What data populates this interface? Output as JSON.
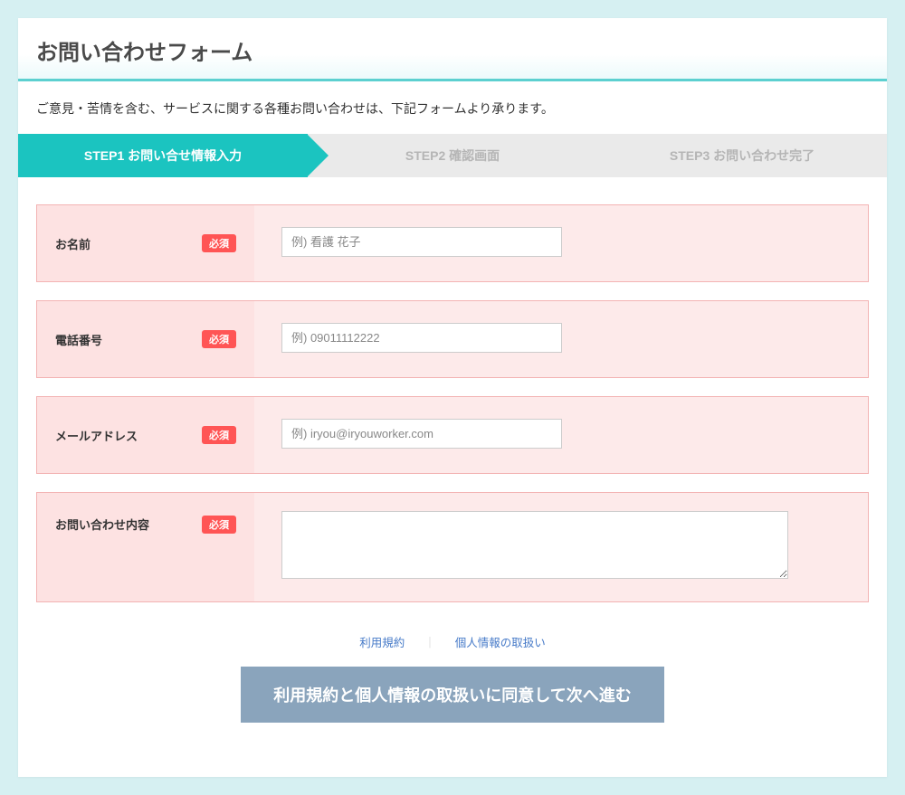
{
  "title": "お問い合わせフォーム",
  "intro": "ご意見・苦情を含む、サービスに関する各種お問い合わせは、下記フォームより承ります。",
  "steps": {
    "step1": "STEP1  お問い合せ情報入力",
    "step2": "STEP2  確認画面",
    "step3": "STEP3  お問い合わせ完了"
  },
  "fields": {
    "name": {
      "label": "お名前",
      "placeholder": "例) 看護 花子"
    },
    "tel": {
      "label": "電話番号",
      "placeholder": "例) 09011112222"
    },
    "email": {
      "label": "メールアドレス",
      "placeholder": "例) iryou@iryouworker.com"
    },
    "content": {
      "label": "お問い合わせ内容",
      "placeholder": ""
    }
  },
  "required_label": "必須",
  "links": {
    "terms": "利用規約",
    "privacy": "個人情報の取扱い"
  },
  "submit": "利用規約と個人情報の取扱いに同意して次へ進む"
}
